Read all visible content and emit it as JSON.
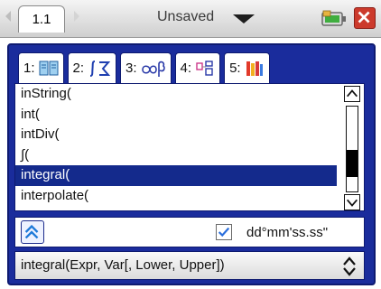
{
  "header": {
    "page_tab": "1.1",
    "title": "Unsaved"
  },
  "catalog": {
    "tabs": [
      {
        "number": "1:",
        "icon": "book-icon"
      },
      {
        "number": "2:",
        "icon": "integral-sum-icon"
      },
      {
        "number": "3:",
        "icon": "infinity-beta-icon"
      },
      {
        "number": "4:",
        "icon": "template-icon"
      },
      {
        "number": "5:",
        "icon": "library-icon"
      }
    ],
    "list_items": [
      "inString(",
      "int(",
      "intDiv(",
      "∫(",
      "integral(",
      "interpolate("
    ],
    "selected_item": "integral(",
    "dms_option_label": "dd°mm'ss.ss\"",
    "dms_checked": true,
    "syntax": "integral(Expr, Var[, Lower, Upper])"
  },
  "colors": {
    "dialog_blue": "#1a2c9c",
    "selection_blue": "#142a8c",
    "check_blue": "#2a6edc",
    "close_red": "#cc3a2c"
  }
}
